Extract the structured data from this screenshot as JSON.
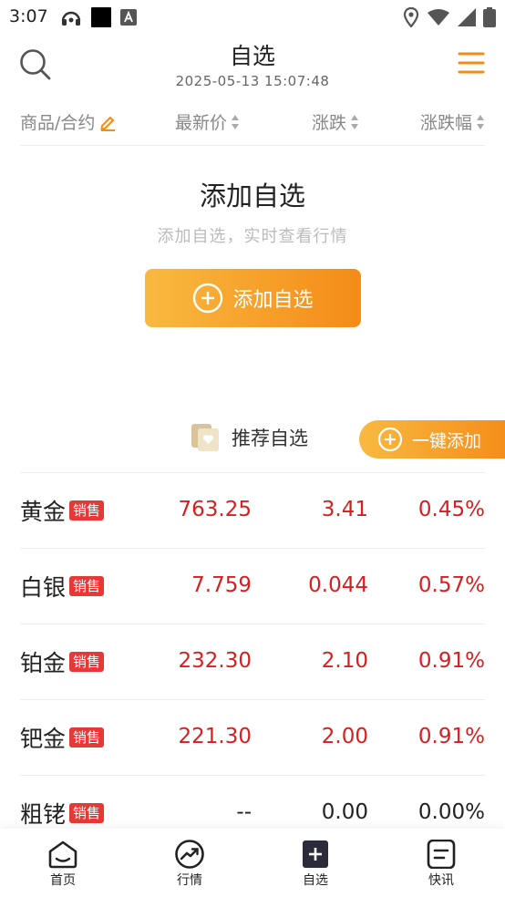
{
  "status_bar": {
    "time": "3:07"
  },
  "header": {
    "title": "自选",
    "datetime": "2025-05-13 15:07:48"
  },
  "columns": {
    "name": "商品/合约",
    "price": "最新价",
    "change": "涨跌",
    "pct": "涨跌幅"
  },
  "empty_state": {
    "title": "添加自选",
    "subtitle": "添加自选，实时查看行情",
    "button_label": "添加自选"
  },
  "recommend": {
    "label": "推荐自选",
    "onekey_label": "一键添加"
  },
  "rows": [
    {
      "name": "黄金",
      "badge": "销售",
      "price": "763.25",
      "change": "3.41",
      "pct": "0.45%"
    },
    {
      "name": "白银",
      "badge": "销售",
      "price": "7.759",
      "change": "0.044",
      "pct": "0.57%"
    },
    {
      "name": "铂金",
      "badge": "销售",
      "price": "232.30",
      "change": "2.10",
      "pct": "0.91%"
    },
    {
      "name": "钯金",
      "badge": "销售",
      "price": "221.30",
      "change": "2.00",
      "pct": "0.91%"
    },
    {
      "name": "粗铑",
      "badge": "销售",
      "price": "--",
      "change": "0.00",
      "pct": "0.00%"
    }
  ],
  "tabs": [
    {
      "label": "首页",
      "icon": "home-icon"
    },
    {
      "label": "行情",
      "icon": "trend-icon"
    },
    {
      "label": "自选",
      "icon": "plus-square-icon"
    },
    {
      "label": "快讯",
      "icon": "news-icon"
    }
  ],
  "colors": {
    "accent": "#f48b17",
    "up_red": "#d81e1e",
    "badge_red": "#e53935"
  }
}
